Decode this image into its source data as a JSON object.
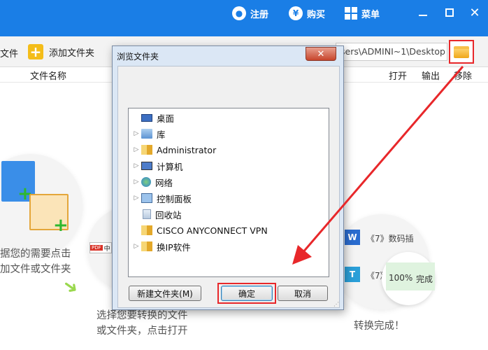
{
  "topbar": {
    "register_label": "注册",
    "purchase_label": "购买",
    "menu_label": "菜单",
    "register_icon": "user-icon",
    "purchase_icon": "yen-icon",
    "menu_icon": "grid-icon"
  },
  "toolbar": {
    "left_partial_label": "文件",
    "add_folder_label": "添加文件夹",
    "path_value": "sers\\ADMINI~1\\Desktop"
  },
  "file_header": {
    "name_col": "文件名称",
    "open_label": "打开",
    "output_label": "输出",
    "remove_label": "移除"
  },
  "illustrations": {
    "left_text_line1": "据您的需要点击",
    "left_text_line2": "加文件或文件夹",
    "pdf_chip": "中",
    "middle_text_line1": "选择您要转换的文件",
    "middle_text_line2": "或文件夹，点击打开",
    "right_item1": "《7》数码插",
    "right_item2": "《7》",
    "progress_percent": "100%",
    "progress_status": "完成",
    "done_text": "转换完成！"
  },
  "dialog": {
    "title": "浏览文件夹",
    "close_symbol": "✕",
    "tree": [
      {
        "label": "桌面",
        "icon": "desktop-icon",
        "expandable": false,
        "selected": true
      },
      {
        "label": "库",
        "icon": "library-icon",
        "expandable": true
      },
      {
        "label": "Administrator",
        "icon": "user-folder-icon",
        "expandable": true
      },
      {
        "label": "计算机",
        "icon": "computer-icon",
        "expandable": true
      },
      {
        "label": "网络",
        "icon": "network-icon",
        "expandable": true
      },
      {
        "label": "控制面板",
        "icon": "control-panel-icon",
        "expandable": true
      },
      {
        "label": "回收站",
        "icon": "recycle-bin-icon",
        "expandable": false
      },
      {
        "label": "CISCO ANYCONNECT VPN",
        "icon": "folder-icon",
        "expandable": false
      },
      {
        "label": "换IP软件",
        "icon": "folder-icon",
        "expandable": true
      }
    ],
    "new_folder_label": "新建文件夹(M)",
    "ok_label": "确定",
    "cancel_label": "取消"
  },
  "colors": {
    "topbar_blue": "#1a7ee6",
    "highlight_red": "#e8272a",
    "dialog_frame": "#dbe7f5"
  }
}
